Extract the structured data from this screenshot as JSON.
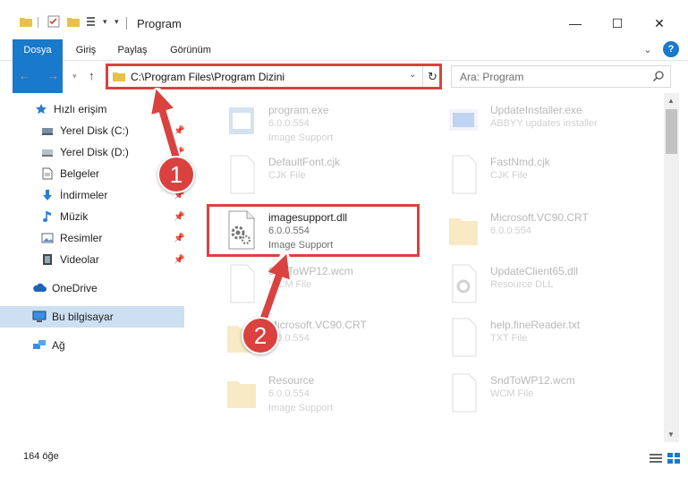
{
  "window": {
    "title": "Program",
    "minimize": "—",
    "maximize": "☐",
    "close": "✕"
  },
  "ribbon": {
    "tabs": [
      "Dosya",
      "Giriş",
      "Paylaş",
      "Görünüm"
    ],
    "expand": "⌄",
    "help": "?"
  },
  "address": {
    "path": "C:\\Program Files\\Program Dizini",
    "search_placeholder": "Ara: Program"
  },
  "sidebar": {
    "items": [
      {
        "label": "Hızlı erişim"
      },
      {
        "label": "Yerel Disk (C:)"
      },
      {
        "label": "Yerel Disk (D:)"
      },
      {
        "label": "Belgeler"
      },
      {
        "label": "İndirmeler"
      },
      {
        "label": "Müzik"
      },
      {
        "label": "Resimler"
      },
      {
        "label": "Videolar"
      },
      {
        "label": "OneDrive"
      },
      {
        "label": "Bu bilgisayar"
      },
      {
        "label": "Ağ"
      }
    ]
  },
  "files": [
    {
      "name": "program.exe",
      "version": "6.0.0.554",
      "desc": "Image Support"
    },
    {
      "name": "UpdateInstaller.exe",
      "version": "ABBYY updates installer",
      "desc": ""
    },
    {
      "name": "DefaultFont.cjk",
      "version": "CJK File",
      "desc": ""
    },
    {
      "name": "FastNmd.cjk",
      "version": "CJK File",
      "desc": ""
    },
    {
      "name": "imagesupport.dll",
      "version": "6.0.0.554",
      "desc": "Image Support"
    },
    {
      "name": "Microsoft.VC90.CRT",
      "version": "6.0.0.554",
      "desc": ""
    },
    {
      "name": "SndToWP12.wcm",
      "version": "WCM File",
      "desc": ""
    },
    {
      "name": "UpdateClient65.dll",
      "version": "Resource DLL",
      "desc": ""
    },
    {
      "name": "Microsoft.VC90.CRT",
      "version": "6.0.0.554",
      "desc": ""
    },
    {
      "name": "help.fineReader.txt",
      "version": "TXT File",
      "desc": ""
    },
    {
      "name": "Resource",
      "version": "6.0.0.554",
      "desc": "Image Support"
    },
    {
      "name": "SndToWP12.wcm",
      "version": "WCM File",
      "desc": ""
    }
  ],
  "status": {
    "count": "164 öğe"
  },
  "annotations": {
    "step1": "1",
    "step2": "2"
  },
  "colors": {
    "accent": "#1979ca",
    "highlight": "#d9423f",
    "selected_bg": "#cce0f2"
  }
}
